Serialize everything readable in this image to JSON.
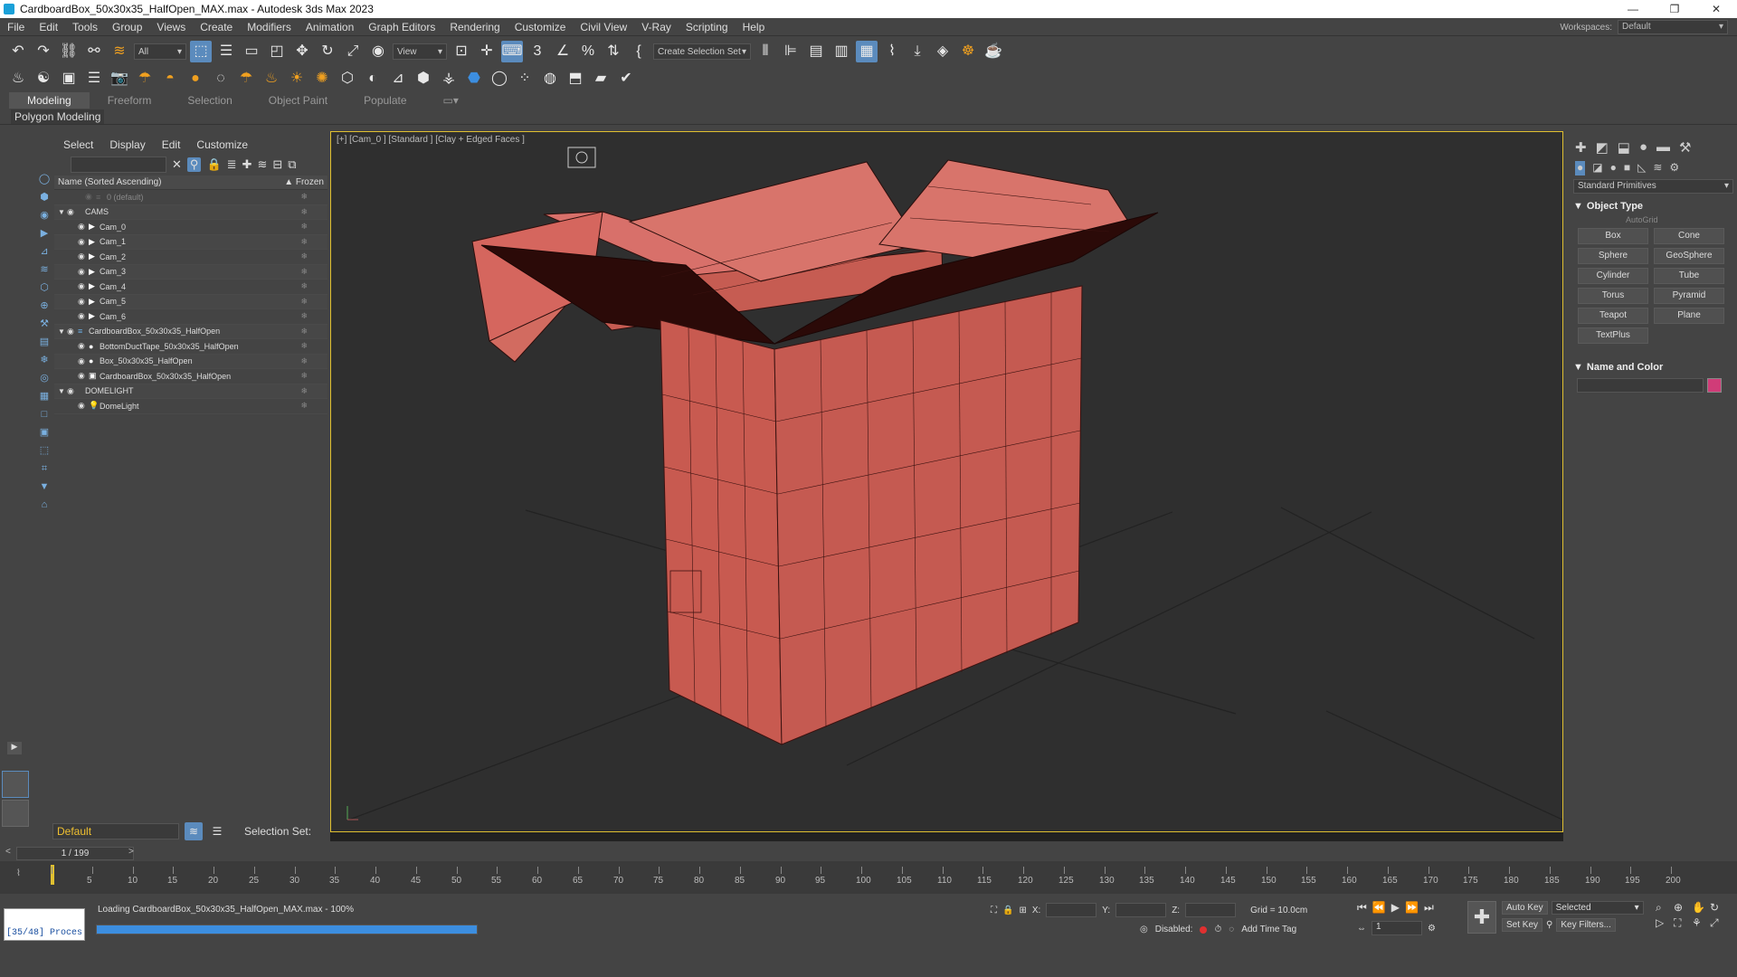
{
  "window": {
    "title": "CardboardBox_50x30x35_HalfOpen_MAX.max - Autodesk 3ds Max 2023"
  },
  "menu": [
    "File",
    "Edit",
    "Tools",
    "Group",
    "Views",
    "Create",
    "Modifiers",
    "Animation",
    "Graph Editors",
    "Rendering",
    "Customize",
    "Civil View",
    "V-Ray",
    "Scripting",
    "Help"
  ],
  "workspace": {
    "label": "Workspaces:",
    "value": "Default"
  },
  "toolbar": {
    "filter": "All",
    "refcoord": "View",
    "selection_set": "Create Selection Set"
  },
  "ribbon": {
    "tabs": [
      "Modeling",
      "Freeform",
      "Selection",
      "Object Paint",
      "Populate"
    ],
    "sub": "Polygon Modeling"
  },
  "explorer": {
    "menu": [
      "Select",
      "Display",
      "Edit",
      "Customize"
    ],
    "col_name": "Name (Sorted Ascending)",
    "col_frozen": "▲ Frozen",
    "rows": [
      {
        "name": "0 (default)",
        "indent": 0
      },
      {
        "name": "CAMS",
        "indent": 0
      },
      {
        "name": "Cam_0",
        "indent": 1
      },
      {
        "name": "Cam_1",
        "indent": 1
      },
      {
        "name": "Cam_2",
        "indent": 1
      },
      {
        "name": "Cam_3",
        "indent": 1
      },
      {
        "name": "Cam_4",
        "indent": 1
      },
      {
        "name": "Cam_5",
        "indent": 1
      },
      {
        "name": "Cam_6",
        "indent": 1
      },
      {
        "name": "CardboardBox_50x30x35_HalfOpen",
        "indent": 0
      },
      {
        "name": "BottomDuctTape_50x30x35_HalfOpen",
        "indent": 1
      },
      {
        "name": "Box_50x30x35_HalfOpen",
        "indent": 1
      },
      {
        "name": "CardboardBox_50x30x35_HalfOpen",
        "indent": 1
      },
      {
        "name": "DOMELIGHT",
        "indent": 0
      },
      {
        "name": "DomeLight",
        "indent": 1
      }
    ],
    "layer": "Default",
    "selection_set_label": "Selection Set:"
  },
  "viewport": {
    "label": "[+] [Cam_0 ] [Standard ] [Clay + Edged Faces ]"
  },
  "command_panel": {
    "dropdown": "Standard Primitives",
    "object_type": "Object Type",
    "autogrid": "AutoGrid",
    "buttons": [
      "Box",
      "Cone",
      "Sphere",
      "GeoSphere",
      "Cylinder",
      "Tube",
      "Torus",
      "Pyramid",
      "Teapot",
      "Plane",
      "TextPlus"
    ],
    "name_color": "Name and Color",
    "swatch_color": "#d03c78"
  },
  "timeline": {
    "counter": "1 / 199",
    "ticks": [
      0,
      5,
      10,
      15,
      20,
      25,
      30,
      35,
      40,
      45,
      50,
      55,
      60,
      65,
      70,
      75,
      80,
      85,
      90,
      95,
      100,
      105,
      110,
      115,
      120,
      125,
      130,
      135,
      140,
      145,
      150,
      155,
      160,
      165,
      170,
      175,
      180,
      185,
      190,
      195,
      200
    ]
  },
  "status": {
    "maxscript": "[35/48] Proces",
    "message": "Loading CardboardBox_50x30x35_HalfOpen_MAX.max -  100%",
    "progress_fraction": 1.0,
    "x_label": "X:",
    "y_label": "Y:",
    "z_label": "Z:",
    "grid": "Grid = 10.0cm",
    "disabled": "Disabled:",
    "add_time_tag": "Add Time Tag",
    "frame": "1",
    "auto_key": "Auto Key",
    "set_key": "Set Key",
    "key_mode": "Selected",
    "key_filters": "Key Filters..."
  }
}
